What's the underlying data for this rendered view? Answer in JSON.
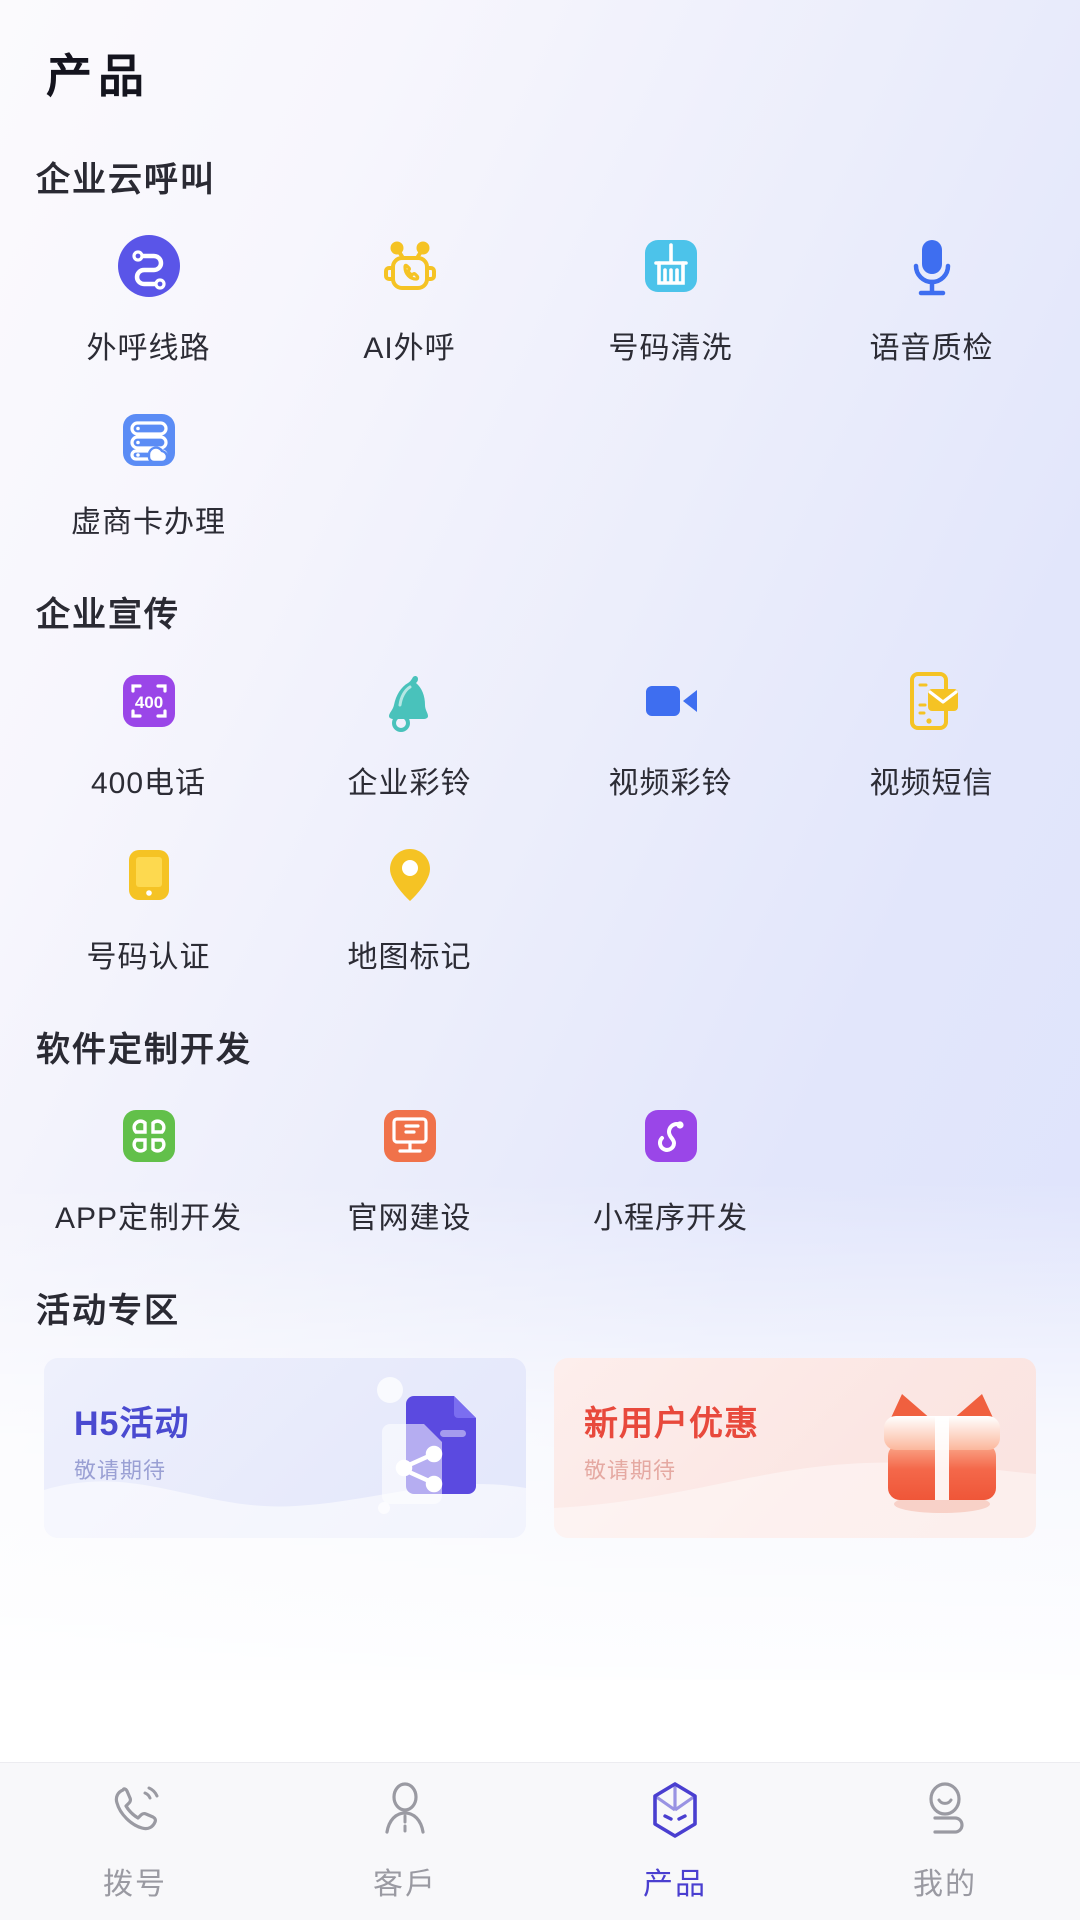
{
  "header": {
    "title": "产品"
  },
  "sections": [
    {
      "id": "cloud-call",
      "title": "企业云呼叫",
      "items": [
        {
          "label": "外呼线路",
          "icon": "route-circle-icon",
          "color": "#5a55e8"
        },
        {
          "label": "AI外呼",
          "icon": "robot-phone-icon",
          "color": "#f5c324"
        },
        {
          "label": "号码清洗",
          "icon": "broom-clean-icon",
          "color": "#4cc3ea"
        },
        {
          "label": "语音质检",
          "icon": "microphone-icon",
          "color": "#3e6ef0"
        },
        {
          "label": "虚商卡办理",
          "icon": "server-cloud-icon",
          "color": "#5b8cf5"
        }
      ]
    },
    {
      "id": "promotion",
      "title": "企业宣传",
      "items": [
        {
          "label": "400电话",
          "icon": "400-phone-icon",
          "color": "#9a46e8"
        },
        {
          "label": "企业彩铃",
          "icon": "bell-ring-icon",
          "color": "#49c2bb"
        },
        {
          "label": "视频彩铃",
          "icon": "video-camera-icon",
          "color": "#3e6ef0"
        },
        {
          "label": "视频短信",
          "icon": "phone-message-icon",
          "color": "#f5c324"
        },
        {
          "label": "号码认证",
          "icon": "phone-verify-icon",
          "color": "#f5c324"
        },
        {
          "label": "地图标记",
          "icon": "map-pin-icon",
          "color": "#f5c324"
        }
      ]
    },
    {
      "id": "software",
      "title": "软件定制开发",
      "items": [
        {
          "label": "APP定制开发",
          "icon": "app-grid-icon",
          "color": "#62c04a"
        },
        {
          "label": "官网建设",
          "icon": "monitor-icon",
          "color": "#f0724a"
        },
        {
          "label": "小程序开发",
          "icon": "miniprogram-icon",
          "color": "#9a46e8"
        }
      ]
    }
  ],
  "activity": {
    "title": "活动专区",
    "banners": [
      {
        "id": "h5",
        "title": "H5活动",
        "subtitle": "敬请期待",
        "art": "share-document-icon",
        "accent": "#4a4ad0"
      },
      {
        "id": "gift",
        "title": "新用户优惠",
        "subtitle": "敬请期待",
        "art": "gift-box-icon",
        "accent": "#e8493c"
      }
    ]
  },
  "tabbar": {
    "active_color": "#4a3fd0",
    "inactive_color": "#9a9aa2",
    "items": [
      {
        "label": "拨号",
        "icon": "phone-call-icon",
        "active": false
      },
      {
        "label": "客戶",
        "icon": "customer-person-icon",
        "active": false
      },
      {
        "label": "产品",
        "icon": "cube-box-icon",
        "active": true
      },
      {
        "label": "我的",
        "icon": "user-profile-icon",
        "active": false
      }
    ]
  }
}
